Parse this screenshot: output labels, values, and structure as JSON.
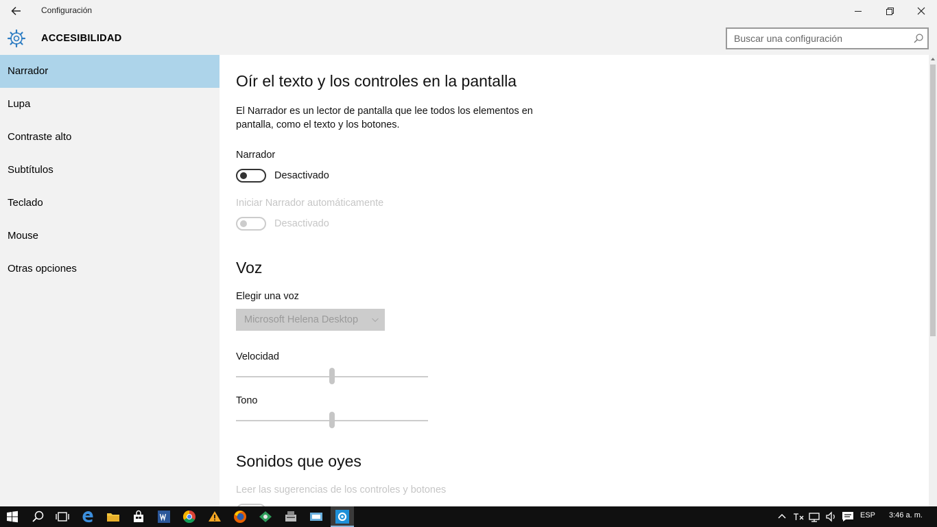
{
  "window": {
    "title": "Configuración"
  },
  "header": {
    "section": "ACCESIBILIDAD",
    "search_placeholder": "Buscar una configuración"
  },
  "sidebar": {
    "items": [
      "Narrador",
      "Lupa",
      "Contraste alto",
      "Subtítulos",
      "Teclado",
      "Mouse",
      "Otras opciones"
    ],
    "active_index": 0
  },
  "main": {
    "heading": "Oír el texto y los controles en la pantalla",
    "description": "El Narrador es un lector de pantalla que lee todos los elementos en pantalla, como el texto y los botones.",
    "narrator": {
      "label": "Narrador",
      "state": "Desactivado"
    },
    "autostart": {
      "label": "Iniciar Narrador automáticamente",
      "state": "Desactivado"
    },
    "voice": {
      "heading": "Voz",
      "choose_label": "Elegir una voz",
      "selected": "Microsoft Helena Desktop",
      "speed_label": "Velocidad",
      "speed_value_fraction": 0.5,
      "pitch_label": "Tono",
      "pitch_value_fraction": 0.5
    },
    "sounds": {
      "heading": "Sonidos que oyes",
      "hints_label": "Leer las sugerencias de los controles y botones"
    }
  },
  "taskbar": {
    "language": "ESP",
    "time": "3:46 a. m."
  },
  "colors": {
    "accent": "#2d7dc3",
    "selection": "#add4ea",
    "taskbar": "#101010"
  }
}
